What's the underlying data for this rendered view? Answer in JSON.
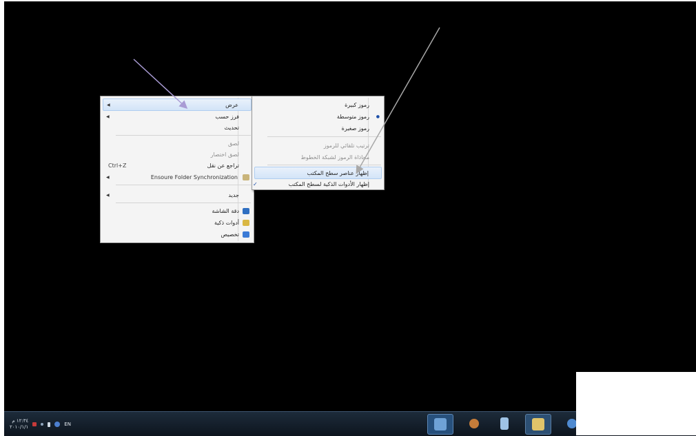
{
  "colors": {
    "desktop": "#000000",
    "menu_bg": "#f4f4f4",
    "arrow_left": "#a99bd4",
    "arrow_right": "#a8a8a8",
    "highlight": "#d3e4f8"
  },
  "context_menu": {
    "items": [
      {
        "label": "عرض",
        "submenu": true,
        "highlighted": true
      },
      {
        "label": "فرز حسب",
        "submenu": true
      },
      {
        "label": "تحديث"
      },
      {
        "label": "لصق",
        "disabled": true
      },
      {
        "label": "لصق اختصار",
        "disabled": true
      },
      {
        "label": "تراجع عن نقل",
        "shortcut": "Ctrl+Z"
      },
      {
        "label": "Ensoure Folder Synchronization",
        "submenu": true,
        "icon": "sync-icon"
      },
      {
        "label": "جديد",
        "submenu": true
      },
      {
        "label": "دقة الشاشة",
        "icon": "display-icon"
      },
      {
        "label": "أدوات ذكية",
        "icon": "gadgets-icon"
      },
      {
        "label": "تخصيص",
        "icon": "personalize-icon"
      }
    ]
  },
  "view_submenu": {
    "items": [
      {
        "label": "رموز كبيرة"
      },
      {
        "label": "رموز متوسطة",
        "selected": true
      },
      {
        "label": "رموز صغيرة"
      },
      {
        "label": "ترتيب تلقائي للرموز",
        "disabled": true
      },
      {
        "label": "محاذاة الرموز لشبكة الخطوط",
        "disabled": true
      },
      {
        "label": "إظهار عناصر سطح المكتب",
        "highlighted": true
      },
      {
        "label": "إظهار الأدوات الذكية لسطح المكتب",
        "checked": true
      }
    ],
    "radio_mark": "●",
    "check_mark": "✓",
    "submenu_arrow": "◀"
  },
  "taskbar": {
    "clock_time": "١٢:٣٤ م",
    "clock_date": "٢٠١٠/١/١",
    "language": "EN"
  }
}
